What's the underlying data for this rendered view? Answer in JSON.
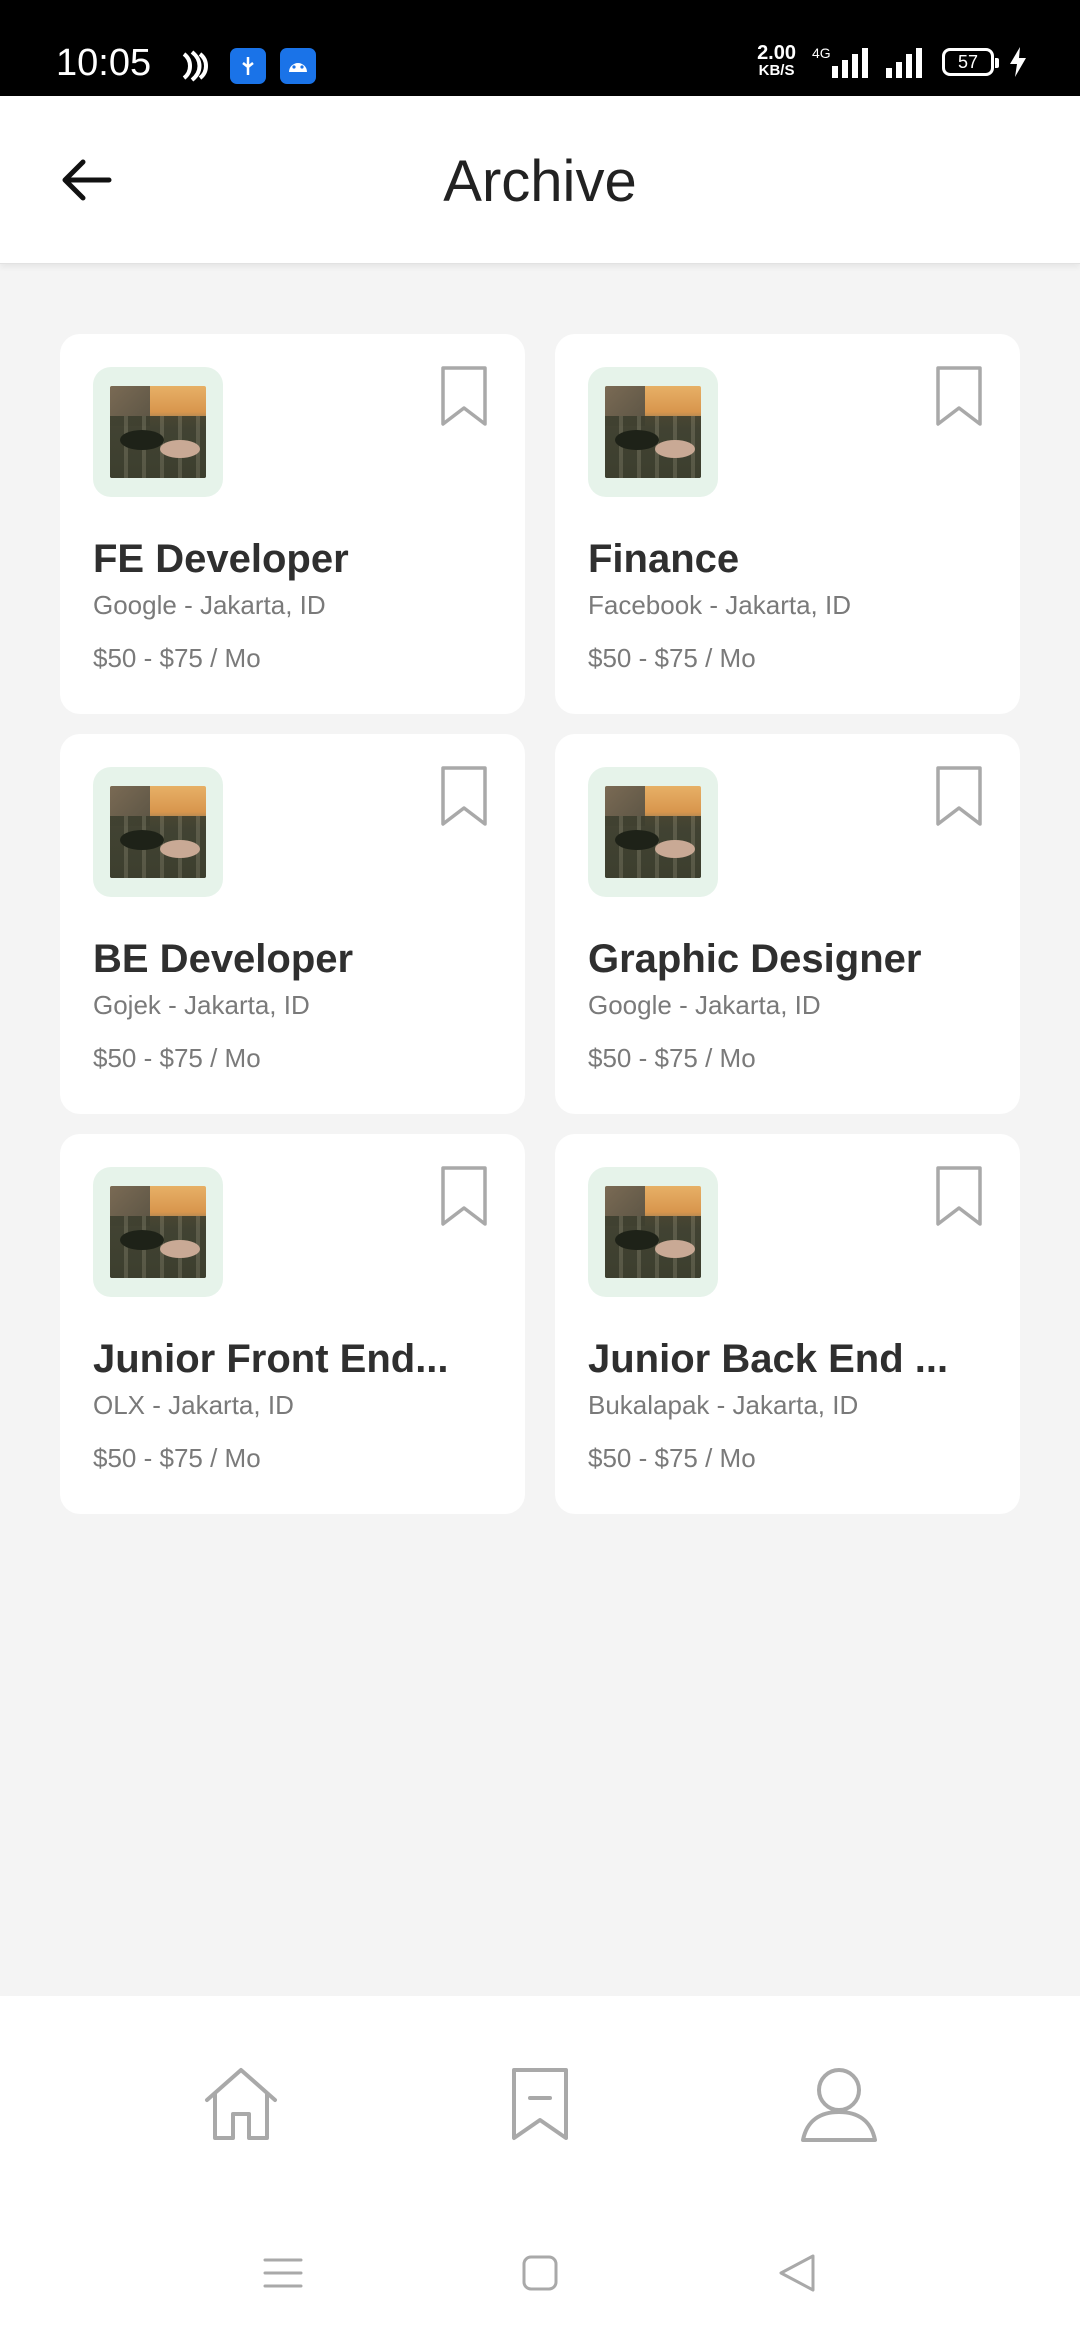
{
  "status_bar": {
    "time": "10:05",
    "speed_value": "2.00",
    "speed_unit": "KB/S",
    "network": "4G",
    "battery": "57",
    "icons": [
      "nfc-icon",
      "usb-icon",
      "android-icon",
      "signal-icon",
      "signal-icon",
      "charging-icon"
    ]
  },
  "header": {
    "title": "Archive",
    "back_icon": "back-arrow-icon"
  },
  "jobs": [
    {
      "title": "FE Developer",
      "company": "Google - Jakarta, ID",
      "salary": "$50 - $75 / Mo"
    },
    {
      "title": "Finance",
      "company": "Facebook - Jakarta, ID",
      "salary": "$50 - $75 / Mo"
    },
    {
      "title": "BE Developer",
      "company": "Gojek - Jakarta, ID",
      "salary": "$50 - $75 / Mo"
    },
    {
      "title": "Graphic Designer",
      "company": "Google - Jakarta, ID",
      "salary": "$50 - $75 / Mo"
    },
    {
      "title": "Junior Front End...",
      "company": "OLX - Jakarta, ID",
      "salary": "$50 - $75 / Mo"
    },
    {
      "title": "Junior Back End ...",
      "company": "Bukalapak - Jakarta, ID",
      "salary": "$50 - $75 / Mo"
    }
  ],
  "bottom_nav": {
    "items": [
      "home-icon",
      "archive-icon",
      "profile-icon"
    ]
  },
  "system_nav": {
    "items": [
      "menu-icon",
      "home-square-icon",
      "back-triangle-icon"
    ]
  },
  "colors": {
    "background": "#f4f4f4",
    "logo_bg": "#e6f3ea",
    "text_dark": "#2f2f2f",
    "text_muted": "#7a7a7a",
    "icon_gray": "#a9a9a9"
  }
}
